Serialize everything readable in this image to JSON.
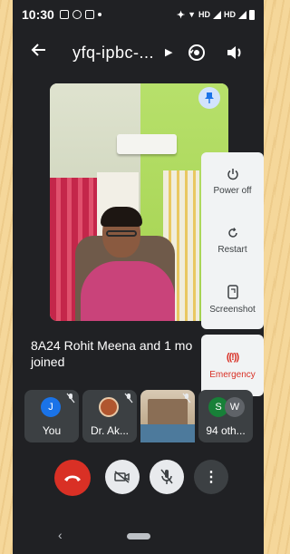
{
  "status_bar": {
    "time": "10:30",
    "network_label_1": "HD",
    "network_label_2": "HD"
  },
  "header": {
    "meeting_code": "yfq-ipbc-...",
    "back_icon": "arrow-left-icon",
    "switch_camera_icon": "switch-camera-icon",
    "audio_icon": "speaker-icon"
  },
  "main_video": {
    "pin_icon": "pin-icon"
  },
  "power_menu": {
    "items": [
      {
        "label": "Power off",
        "icon": "power-icon"
      },
      {
        "label": "Restart",
        "icon": "restart-icon"
      },
      {
        "label": "Screenshot",
        "icon": "screenshot-icon"
      }
    ],
    "emergency": {
      "label": "Emergency",
      "icon_text": "((!))",
      "color": "#d93025"
    }
  },
  "notification": {
    "text": "8A24 Rohit Meena and 1 mo joined"
  },
  "participants": [
    {
      "initial": "J",
      "name": "You",
      "avatar_color": "#1a73e8"
    },
    {
      "initial": "",
      "name": "Dr. Ak...",
      "avatar_color": "#b0562f"
    },
    {
      "initial": "",
      "name": "",
      "avatar_color": ""
    },
    {
      "initials": [
        "S",
        "W"
      ],
      "name": "94 oth...",
      "avatar_colors": [
        "#188038",
        "#5f6368"
      ]
    }
  ],
  "controls": {
    "hangup_color": "#d93025",
    "more_label": "⋮"
  }
}
